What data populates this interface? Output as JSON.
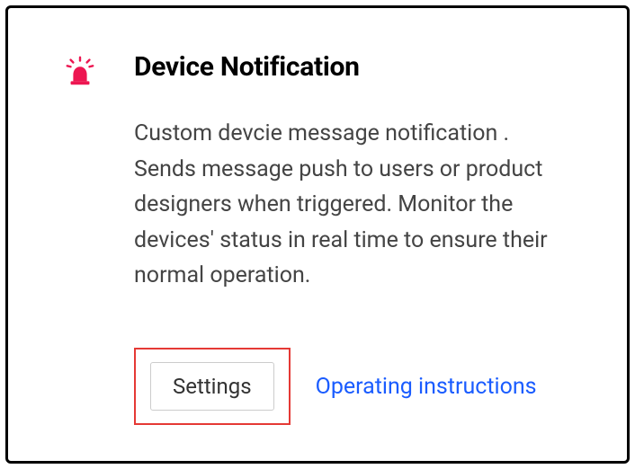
{
  "card": {
    "title": "Device Notification",
    "description": "Custom devcie message notification . Sends message push to users or product designers when triggered. Monitor the devices' status in real time to ensure their normal operation.",
    "settings_label": "Settings",
    "instructions_label": "Operating instructions",
    "icon": "alert-light-icon",
    "accent_color": "#ed1651"
  }
}
